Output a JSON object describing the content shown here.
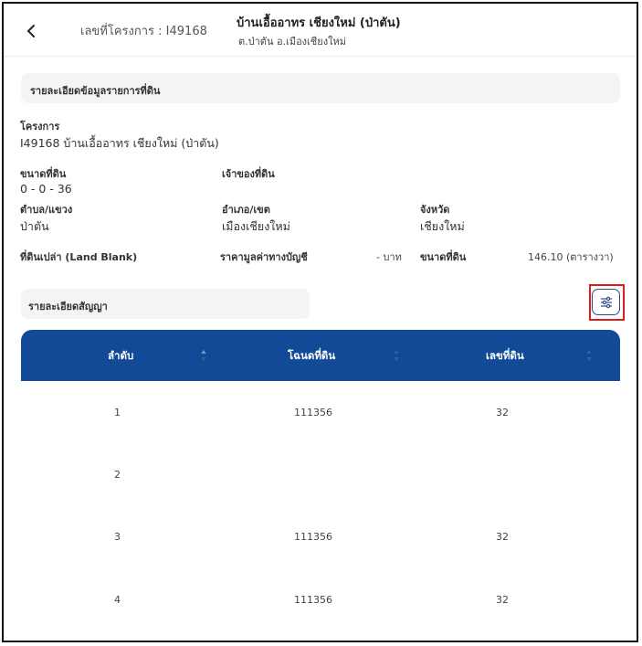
{
  "header": {
    "project_no": "เลขที่โครงการ : I49168",
    "title": "บ้านเอื้ออาทร เชียงใหม่ (ป่าตัน)",
    "subtitle": "ต.ป่าตัน อ.เมืองเชียงใหม่"
  },
  "land_section": {
    "title": "รายละเอียดข้อมูลรายการที่ดิน",
    "project_label": "โครงการ",
    "project_value": "I49168  บ้านเอื้ออาทร เชียงใหม่ (ป่าตัน)",
    "size_label": "ขนาดที่ดิน",
    "size_value": "0 - 0 - 36",
    "owner_label": "เจ้าของที่ดิน",
    "owner_value": "",
    "subdistrict_label": "ตำบล/แขวง",
    "subdistrict_value": "ป่าตัน",
    "district_label": "อำเภอ/เขต",
    "district_value": "เมืองเชียงใหม่",
    "province_label": "จังหวัด",
    "province_value": "เชียงใหม่",
    "land_blank_label": "ที่ดินเปล่า (Land Blank)",
    "book_value_label": "ราคามูลค่าทางบัญชี",
    "book_value": "- บาท",
    "land_area_label": "ขนาดที่ดิน",
    "land_area_value": "146.10 (ตารางวา)"
  },
  "contract_section": {
    "title": "รายละเอียดสัญญา",
    "filter_icon": "sliders-icon"
  },
  "table": {
    "headers": [
      "ลำดับ",
      "โฉนดที่ดิน",
      "เลขที่ดิน"
    ],
    "rows": [
      {
        "no": "1",
        "deed": "111356",
        "land_no": "32"
      },
      {
        "no": "2",
        "deed": "",
        "land_no": ""
      },
      {
        "no": "3",
        "deed": "111356",
        "land_no": "32"
      },
      {
        "no": "4",
        "deed": "111356",
        "land_no": "32"
      }
    ]
  },
  "colors": {
    "table_header": "#134a97",
    "highlight": "#e01b1b",
    "section_bg": "#f4f4f4"
  }
}
